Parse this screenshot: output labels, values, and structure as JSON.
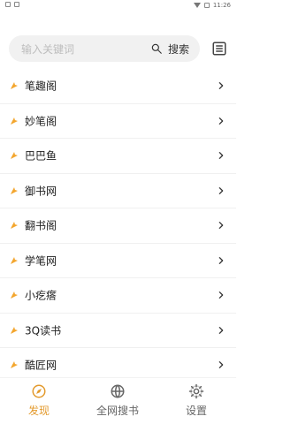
{
  "status_bar": {
    "left_icons": [
      "tiny-box-icon",
      "tiny-box-icon"
    ],
    "time": "11:26"
  },
  "search": {
    "placeholder": "输入关键词",
    "button_label": "搜索",
    "search_icon": "search-icon",
    "list_icon": "list-icon"
  },
  "sources": [
    {
      "label": "笔趣阁"
    },
    {
      "label": "妙笔阁"
    },
    {
      "label": "巴巴鱼"
    },
    {
      "label": "御书网"
    },
    {
      "label": "翻书阁"
    },
    {
      "label": "学笔网"
    },
    {
      "label": "小疙瘩"
    },
    {
      "label": "3Q读书"
    },
    {
      "label": "酷匠网"
    }
  ],
  "bottom_nav": {
    "tabs": [
      {
        "label": "发现",
        "icon": "compass-icon",
        "active": true
      },
      {
        "label": "全网搜书",
        "icon": "globe-icon",
        "active": false
      },
      {
        "label": "设置",
        "icon": "gear-icon",
        "active": false
      }
    ],
    "accent_color": "#e39a2d"
  }
}
